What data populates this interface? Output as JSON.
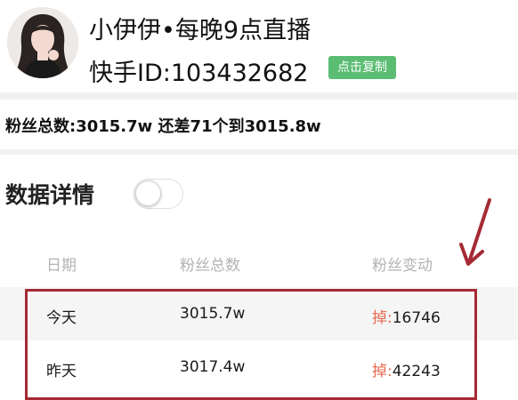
{
  "profile": {
    "nickname": "小伊伊•每晚9点直播",
    "user_id": "快手ID:103432682",
    "copy_label": "点击复制"
  },
  "fans_summary": "粉丝总数:3015.7w 还差71个到3015.8w",
  "details": {
    "label": "数据详情",
    "toggle_on": false
  },
  "table": {
    "headers": [
      "日期",
      "粉丝总数",
      "粉丝变动"
    ],
    "rows": [
      {
        "date": "今天",
        "total": "3015.7w",
        "change_prefix": "掉:",
        "change_value": "16746"
      },
      {
        "date": "昨天",
        "total": "3017.4w",
        "change_prefix": "掉:",
        "change_value": "42243"
      }
    ]
  },
  "colors": {
    "copy_button": "#5bbd74",
    "loss_text": "#e86a50",
    "highlight": "#a52a34"
  }
}
